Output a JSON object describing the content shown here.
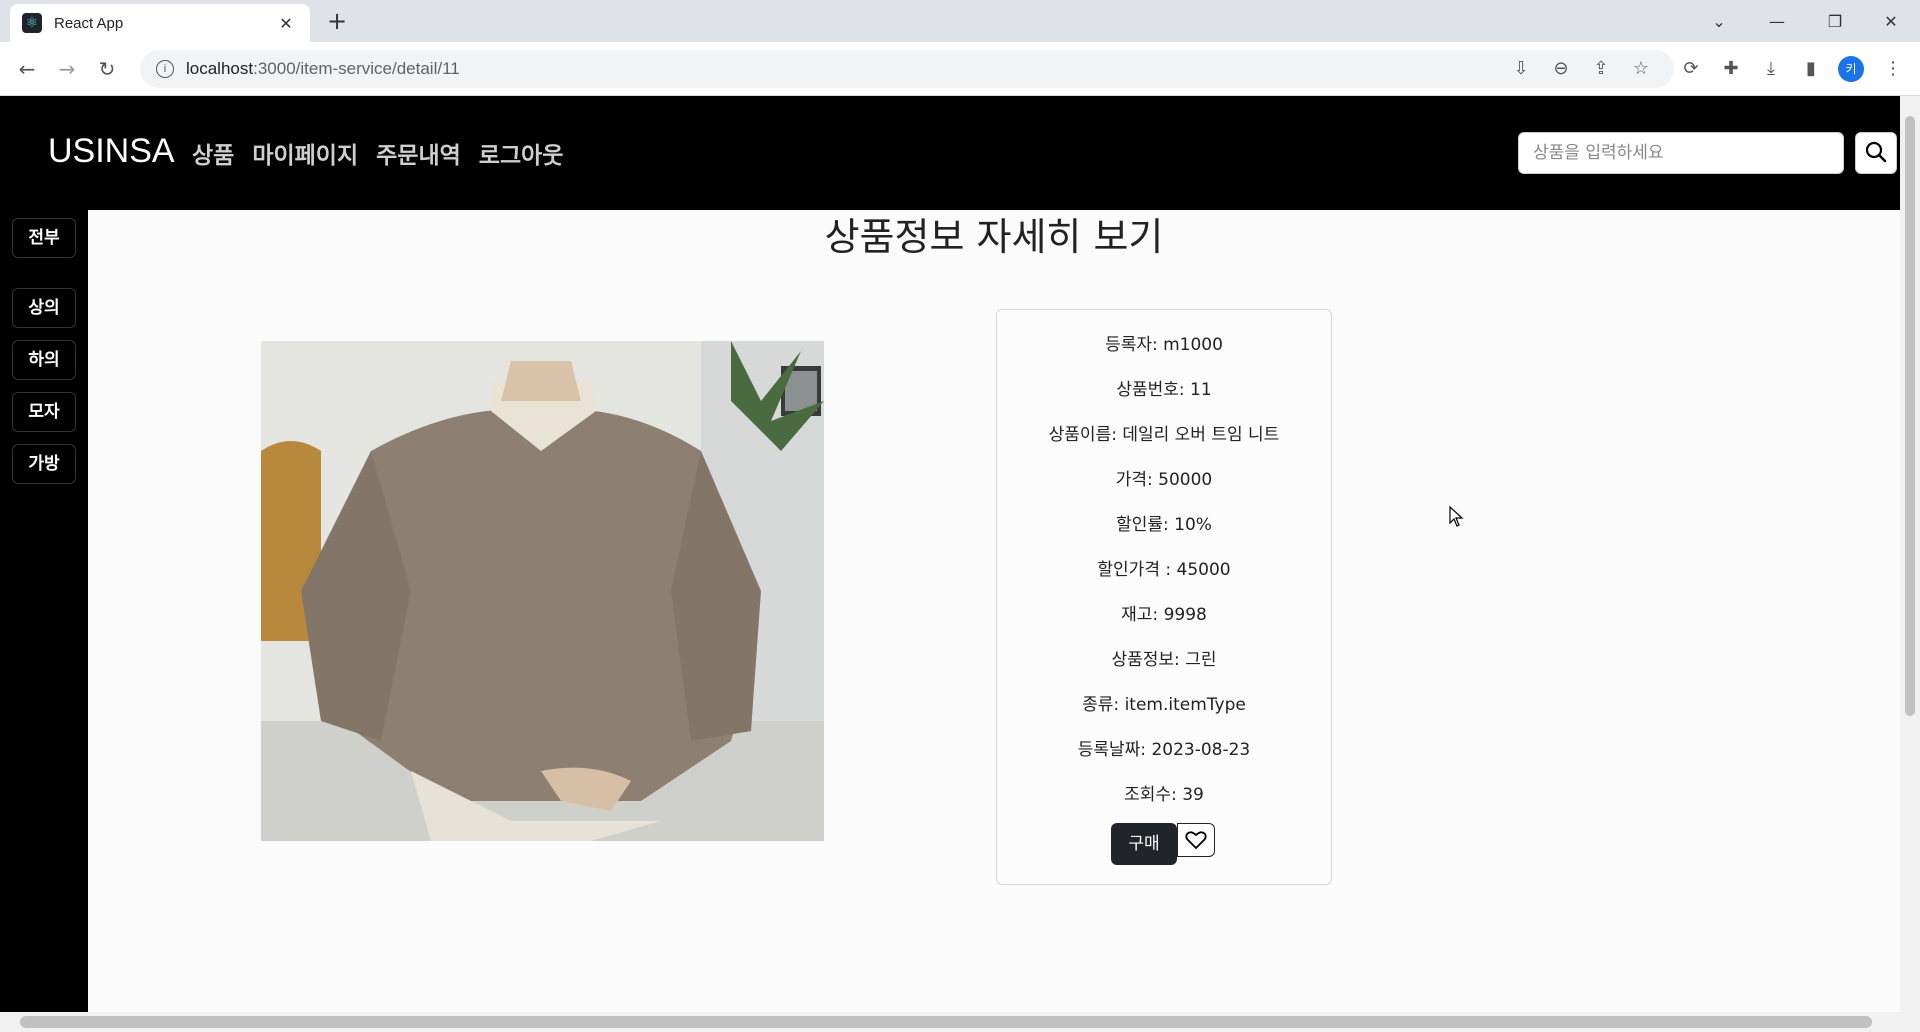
{
  "browser": {
    "tab_title": "React App",
    "tab_close": "✕",
    "new_tab": "+",
    "url_host": "localhost",
    "url_rest": ":3000/item-service/detail/11",
    "profile_initial": "키",
    "win_minimize": "—",
    "win_restore": "❐",
    "win_close": "✕",
    "dropdown": "⌄"
  },
  "nav": {
    "brand": "USINSA",
    "links": [
      "상품",
      "마이페이지",
      "주문내역",
      "로그아웃"
    ],
    "search_placeholder": "상품을 입력하세요"
  },
  "sidebar": {
    "categories": [
      "전부",
      "상의",
      "하의",
      "모자",
      "가방"
    ]
  },
  "page_title": "상품정보 자세히 보기",
  "product": {
    "registrant": "등록자: m1000",
    "id": "상품번호: 11",
    "name": "상품이름: 데일리 오버 트임 니트",
    "price": "가격: 50000",
    "discount_rate": "할인률: 10%",
    "discount_price": "할인가격 : 45000",
    "stock": "재고: 9998",
    "info": "상품정보: 그린",
    "type": "종류: item.itemType",
    "date": "등록날짜: 2023-08-23",
    "views": "조회수: 39",
    "buy_label": "구매"
  },
  "icons": {
    "search": "search-icon",
    "heart": "heart-icon",
    "react": "react-logo-icon"
  }
}
